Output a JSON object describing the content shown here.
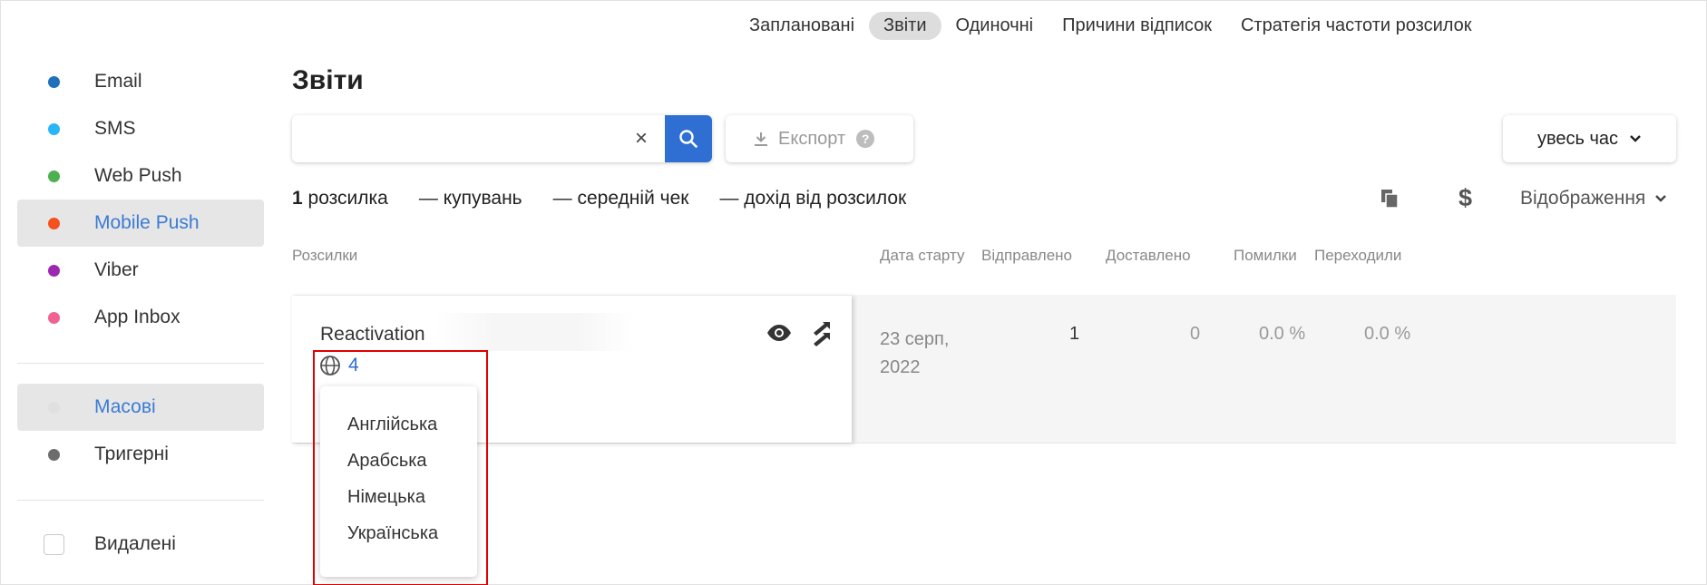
{
  "topnav": {
    "tabs": [
      {
        "label": "Заплановані",
        "active": false
      },
      {
        "label": "Звіти",
        "active": true
      },
      {
        "label": "Одиночні",
        "active": false
      },
      {
        "label": "Причини відписок",
        "active": false
      },
      {
        "label": "Стратегія частоти розсилок",
        "active": false
      }
    ]
  },
  "sidebar": {
    "channels": [
      {
        "label": "Email",
        "color": "#1f6fba",
        "active": false
      },
      {
        "label": "SMS",
        "color": "#29b6f6",
        "active": false
      },
      {
        "label": "Web Push",
        "color": "#4caf50",
        "active": false
      },
      {
        "label": "Mobile Push",
        "color": "#f4511e",
        "active": true
      },
      {
        "label": "Viber",
        "color": "#9c27b0",
        "active": false
      },
      {
        "label": "App Inbox",
        "color": "#f06292",
        "active": false
      }
    ],
    "types": [
      {
        "label": "Масові",
        "color": "#e0e0e0",
        "active": true
      },
      {
        "label": "Тригерні",
        "color": "#6d6d6d",
        "active": false
      }
    ],
    "deleted_label": "Видалені"
  },
  "main": {
    "title": "Звіти",
    "search": {
      "value": "",
      "placeholder": ""
    },
    "export_label": "Експорт",
    "period_label": "увесь час",
    "stats": {
      "count": "1",
      "count_label": "розсилка",
      "purchases": "— купувань",
      "avg_check": "— середній чек",
      "revenue": "— дохід від розсилок"
    },
    "view_label": "Відображення",
    "columns": {
      "name": "Розсилки",
      "start_date": "Дата старту",
      "sent": "Відправлено",
      "delivered": "Доставлено",
      "errors": "Помилки",
      "clicks": "Переходили"
    },
    "row": {
      "name": "Reactivation",
      "languages_count": "4",
      "start_date_line1": "23 серп,",
      "start_date_line2": "2022",
      "sent": "1",
      "delivered": "0",
      "errors": "0.0 %",
      "clicks": "0.0 %"
    },
    "languages_dropdown": [
      "Англійська",
      "Арабська",
      "Німецька",
      "Українська"
    ]
  },
  "colors": {
    "accent": "#2f6fd3",
    "highlight_border": "#e00000"
  }
}
